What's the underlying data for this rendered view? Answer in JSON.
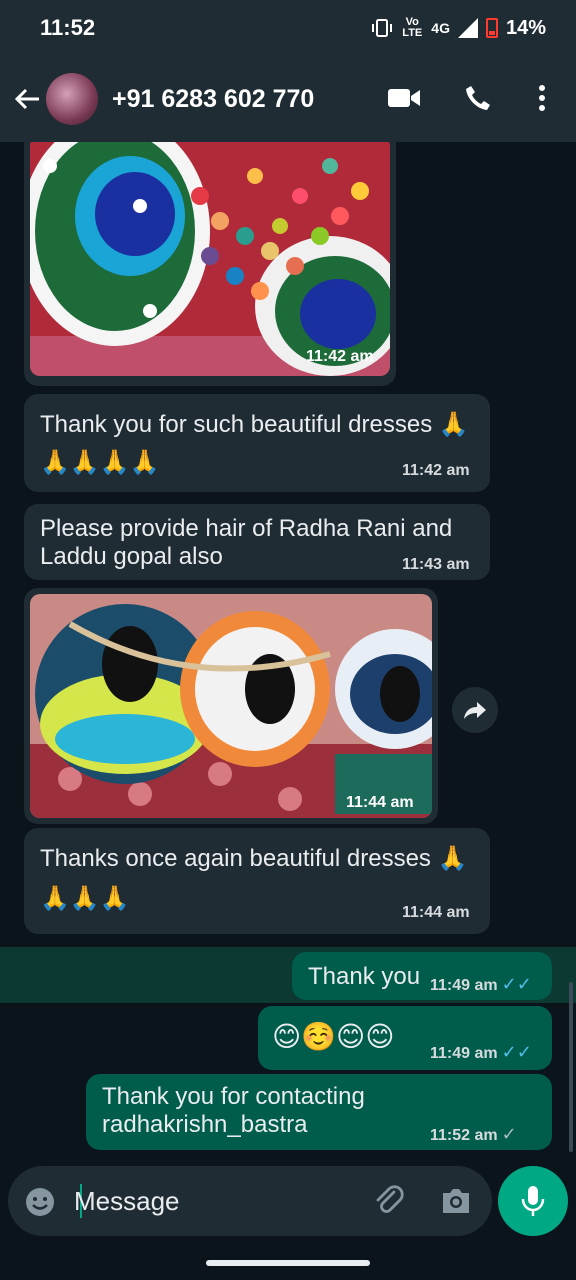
{
  "status_bar": {
    "time": "11:52",
    "volte": "Vo LTE",
    "network": "4G",
    "battery": "14%"
  },
  "header": {
    "contact_name": "+91 6283 602 770",
    "icons": [
      "back-arrow-icon",
      "avatar",
      "video-call-icon",
      "phone-icon",
      "more-options-icon"
    ]
  },
  "messages": [
    {
      "type": "image",
      "direction": "in",
      "time": "11:42 am"
    },
    {
      "type": "text",
      "direction": "in",
      "text": "Thank you for such beautiful dresses 🙏",
      "text2": "🙏🙏🙏🙏",
      "time": "11:42 am"
    },
    {
      "type": "text",
      "direction": "in",
      "text": "Please provide hair of Radha Rani and",
      "text2": "Laddu gopal also",
      "time": "11:43 am"
    },
    {
      "type": "image",
      "direction": "in",
      "time": "11:44 am"
    },
    {
      "type": "text",
      "direction": "in",
      "text": "Thanks once again beautiful dresses 🙏",
      "text2": "🙏🙏🙏",
      "time": "11:44 am"
    },
    {
      "type": "text",
      "direction": "out",
      "text": "Thank you",
      "time": "11:49 am",
      "status": "read"
    },
    {
      "type": "text",
      "direction": "out",
      "text": "😊☺️😊😊",
      "time": "11:49 am",
      "status": "read"
    },
    {
      "type": "text",
      "direction": "out",
      "text": "Thank you for contacting",
      "text2": "radhakrishn_bastra",
      "time": "11:52 am",
      "status": "sent"
    }
  ],
  "composer": {
    "placeholder": "Message"
  },
  "colors": {
    "header_bg": "#1f2c34",
    "chat_bg": "#0b141a",
    "incoming_bubble": "#202c33",
    "outgoing_bubble": "#005c4b",
    "accent": "#00a884",
    "read_ticks": "#53bdeb"
  }
}
